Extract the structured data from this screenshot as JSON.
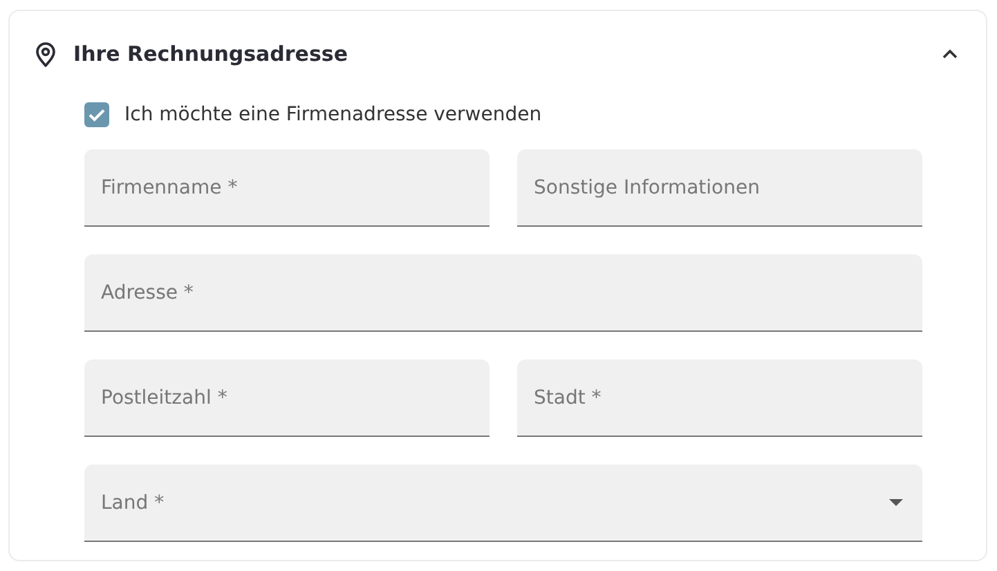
{
  "section": {
    "title": "Ihre Rechnungsadresse",
    "expanded": true
  },
  "company_checkbox": {
    "label": "Ich möchte eine Firmenadresse verwenden",
    "checked": true
  },
  "rows": [
    {
      "fields": [
        {
          "kind": "text",
          "placeholder": "Firmenname *"
        },
        {
          "kind": "text",
          "placeholder": "Sonstige Informationen"
        }
      ]
    },
    {
      "fields": [
        {
          "kind": "text",
          "placeholder": "Adresse *"
        }
      ]
    },
    {
      "fields": [
        {
          "kind": "text",
          "placeholder": "Postleitzahl *"
        },
        {
          "kind": "text",
          "placeholder": "Stadt *"
        }
      ]
    },
    {
      "fields": [
        {
          "kind": "select",
          "placeholder": "Land *"
        }
      ]
    }
  ]
}
